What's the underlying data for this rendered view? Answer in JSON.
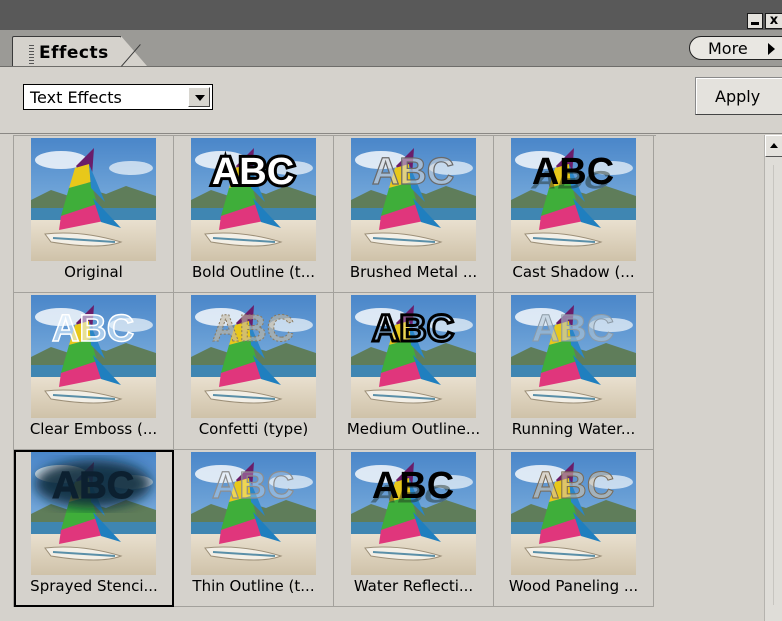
{
  "panel": {
    "tab_label": "Effects",
    "more_label": "More",
    "category_value": "Text Effects",
    "apply_label": "Apply"
  },
  "window_controls": {
    "close_glyph": "x"
  },
  "effects": [
    {
      "label": "Original",
      "style": "none",
      "selected": false
    },
    {
      "label": "Bold Outline (t...",
      "style": "bold",
      "selected": false
    },
    {
      "label": "Brushed Metal ...",
      "style": "metal",
      "selected": false
    },
    {
      "label": "Cast Shadow (...",
      "style": "shadow",
      "selected": false
    },
    {
      "label": "Clear Emboss (...",
      "style": "emboss",
      "selected": false
    },
    {
      "label": "Confetti (type)",
      "style": "confetti",
      "selected": false
    },
    {
      "label": "Medium Outline...",
      "style": "medium",
      "selected": false
    },
    {
      "label": "Running Water...",
      "style": "water",
      "selected": false
    },
    {
      "label": "Sprayed Stenci...",
      "style": "stencil",
      "selected": true
    },
    {
      "label": "Thin Outline (t...",
      "style": "thin",
      "selected": false
    },
    {
      "label": "Water Reflecti...",
      "style": "reflect",
      "selected": false
    },
    {
      "label": "Wood Paneling ...",
      "style": "wood",
      "selected": false
    }
  ],
  "thumbnail_text": "ABC",
  "colors": {
    "titlebar": "#595959",
    "panel_bg": "#d5d2cc",
    "tabstrip": "#9b9a96"
  }
}
